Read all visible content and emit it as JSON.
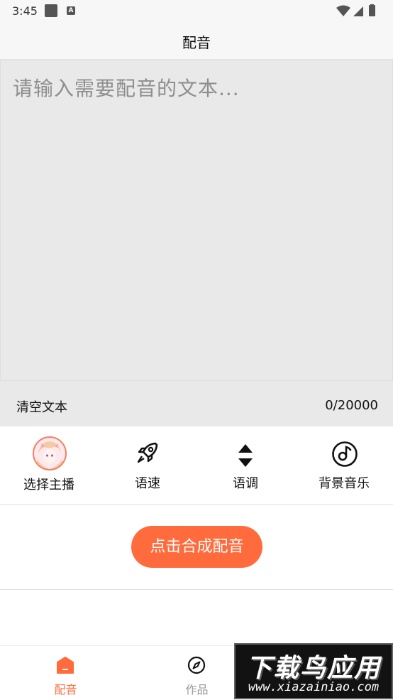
{
  "status_bar": {
    "time": "3:45",
    "notification_icon_letter": "A"
  },
  "header": {
    "title": "配音"
  },
  "editor": {
    "placeholder": "请输入需要配音的文本...",
    "value": ""
  },
  "editor_footer": {
    "clear_label": "清空文本",
    "char_count": "0/20000"
  },
  "toolbar": {
    "items": [
      {
        "label": "选择主播",
        "icon": "anchor-avatar"
      },
      {
        "label": "语速",
        "icon": "rocket-icon"
      },
      {
        "label": "语调",
        "icon": "up-down-arrows-icon"
      },
      {
        "label": "背景音乐",
        "icon": "music-disc-icon"
      }
    ]
  },
  "synth_button": {
    "label": "点击合成配音"
  },
  "bottom_nav": {
    "items": [
      {
        "label": "配音",
        "icon": "home-icon",
        "active": true
      },
      {
        "label": "作品",
        "icon": "compass-icon",
        "active": false
      }
    ]
  },
  "watermark": {
    "title": "下载鸟应用",
    "url": "www.xiazainiao.com"
  },
  "colors": {
    "accent": "#ff6b3d",
    "editor_bg": "#e9e9e9",
    "placeholder": "#8e8e8e",
    "inactive": "#999999"
  }
}
